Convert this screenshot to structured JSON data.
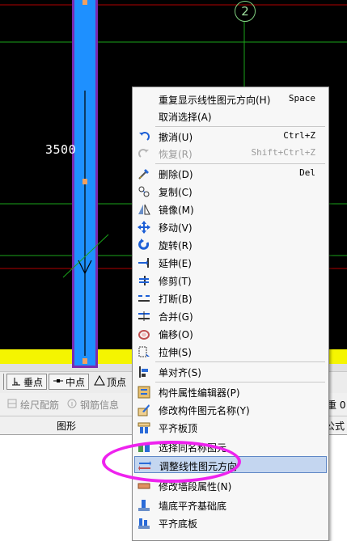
{
  "canvas": {
    "axis_label": "2",
    "dimension_text": "3500"
  },
  "snap_toolbar": {
    "items": [
      {
        "label": "垂点",
        "icon": "perpendicular-snap-icon"
      },
      {
        "label": "中点",
        "icon": "midpoint-snap-icon"
      },
      {
        "label": "顶点",
        "icon": "vertex-snap-icon"
      }
    ]
  },
  "toolbar2": {
    "items": [
      {
        "label": "绘尺配筋",
        "icon": "rebar-drawing-icon"
      },
      {
        "label": "钢筋信息",
        "icon": "rebar-info-icon"
      }
    ],
    "right_text": "重 0"
  },
  "group_bar": {
    "label_graphics": "图形",
    "label_formula": "公式"
  },
  "context_menu": {
    "items": [
      {
        "label": "重复显示线性图元方向(H)",
        "accel": "Space",
        "icon": ""
      },
      {
        "label": "取消选择(A)",
        "accel": "",
        "icon": ""
      },
      {
        "label": "撤消(U)",
        "accel": "Ctrl+Z",
        "icon": "undo-icon"
      },
      {
        "label": "恢复(R)",
        "accel": "Shift+Ctrl+Z",
        "icon": "redo-icon",
        "disabled": true
      },
      {
        "label": "删除(D)",
        "accel": "Del",
        "icon": "delete-icon"
      },
      {
        "label": "复制(C)",
        "accel": "",
        "icon": "copy-icon"
      },
      {
        "label": "镜像(M)",
        "accel": "",
        "icon": "mirror-icon"
      },
      {
        "label": "移动(V)",
        "accel": "",
        "icon": "move-icon"
      },
      {
        "label": "旋转(R)",
        "accel": "",
        "icon": "rotate-icon"
      },
      {
        "label": "延伸(E)",
        "accel": "",
        "icon": "extend-icon"
      },
      {
        "label": "修剪(T)",
        "accel": "",
        "icon": "trim-icon"
      },
      {
        "label": "打断(B)",
        "accel": "",
        "icon": "break-icon"
      },
      {
        "label": "合并(G)",
        "accel": "",
        "icon": "merge-icon"
      },
      {
        "label": "偏移(O)",
        "accel": "",
        "icon": "offset-icon"
      },
      {
        "label": "拉伸(S)",
        "accel": "",
        "icon": "stretch-icon"
      },
      {
        "label": "单对齐(S)",
        "accel": "",
        "icon": "align-icon"
      },
      {
        "label": "构件属性编辑器(P)",
        "accel": "",
        "icon": "property-editor-icon"
      },
      {
        "label": "修改构件图元名称(Y)",
        "accel": "",
        "icon": "rename-icon"
      },
      {
        "label": "平齐板顶",
        "accel": "",
        "icon": "align-slab-top-icon"
      },
      {
        "label": "选择同名称图元",
        "accel": "",
        "icon": "select-same-name-icon"
      },
      {
        "label": "调整线性图元方向",
        "accel": "",
        "icon": "adjust-direction-icon",
        "selected": true
      },
      {
        "label": "修改墙段属性(N)",
        "accel": "",
        "icon": "wall-segment-icon"
      },
      {
        "label": "墙底平齐基础底",
        "accel": "",
        "icon": "wall-base-align-icon"
      },
      {
        "label": "平齐底板",
        "accel": "",
        "icon": "align-bottom-slab-icon"
      }
    ]
  },
  "colors": {
    "canvas_bg": "#000000",
    "wall_fill": "#1e90ff",
    "grid_green": "#1aa31a",
    "grid_red": "#b00000",
    "floor_yellow": "#f5f500",
    "highlight_ellipse": "#ee22ee",
    "menu_selection": "#c4d6f0"
  }
}
